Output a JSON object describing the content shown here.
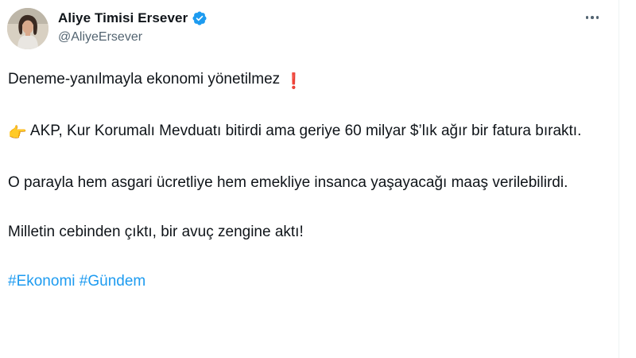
{
  "author": {
    "display_name": "Aliye Timisi Ersever",
    "handle": "@AliyeErsever",
    "avatar_icon": "profile-photo",
    "verified_icon": "verified-badge-icon"
  },
  "menu_icon": "more-options-icon",
  "tweet": {
    "line1": "Deneme-yanılmayla ekonomi yönetilmez",
    "line1_emoji": "❗",
    "para2_emoji": "👉",
    "para2": "AKP, Kur Korumalı Mevduatı bitirdi ama geriye 60 milyar $’lık ağır bir fatura bıraktı.",
    "para3": "O parayla hem asgari ücretliye hem emekliye insanca yaşayacağı maaş verilebilirdi.",
    "para4": "Milletin cebinden çıktı, bir avuç zengine aktı!",
    "hashtags": [
      "#Ekonomi",
      "#Gündem"
    ]
  },
  "colors": {
    "accent": "#1d9bf0",
    "text": "#0f1419",
    "secondary": "#536471"
  }
}
